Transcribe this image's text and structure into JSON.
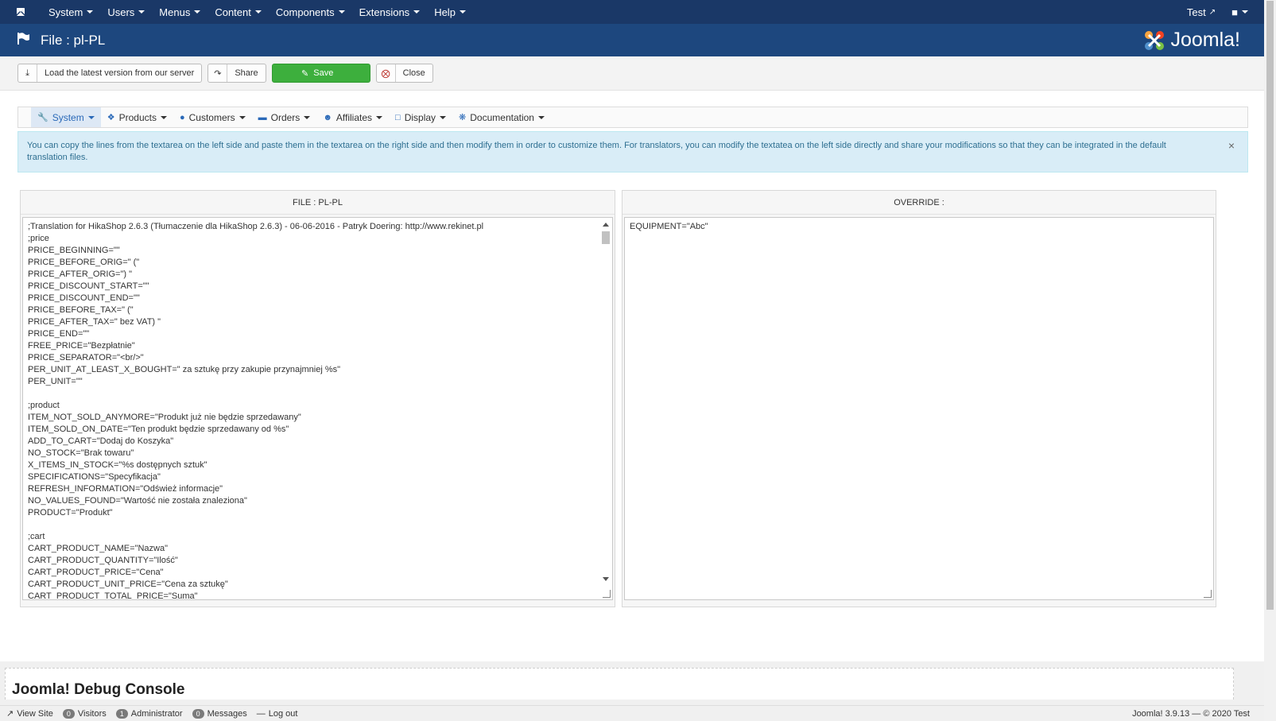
{
  "topnav": {
    "menus": [
      "System",
      "Users",
      "Menus",
      "Content",
      "Components",
      "Extensions",
      "Help"
    ],
    "user_link": "Test"
  },
  "header": {
    "title": "File : pl-PL",
    "brand": "Joomla!"
  },
  "toolbar": {
    "load_label": "Load the latest version from our server",
    "share_label": "Share",
    "save_label": "Save",
    "close_label": "Close"
  },
  "subnav": {
    "items": [
      "System",
      "Products",
      "Customers",
      "Orders",
      "Affiliates",
      "Display",
      "Documentation"
    ],
    "active": "System"
  },
  "alert": {
    "text": "You can copy the lines from the textarea on the left side and paste them in the textarea on the right side and then modify them in order to customize them. For translators, you can modify the textatea on the left side directly and share your modifications so that they can be integrated in the default translation files."
  },
  "file_panel": {
    "header": "FILE : PL-PL",
    "lines": [
      ";Translation for HikaShop 2.6.3 (Tłumaczenie dla HikaShop 2.6.3) - 06-06-2016 - Patryk Doering: http://www.rekinet.pl",
      ";price",
      "PRICE_BEGINNING=\"\"",
      "PRICE_BEFORE_ORIG=\" (\"",
      "PRICE_AFTER_ORIG=\") \"",
      "PRICE_DISCOUNT_START=\"\"",
      "PRICE_DISCOUNT_END=\"\"",
      "PRICE_BEFORE_TAX=\" (\"",
      "PRICE_AFTER_TAX=\" bez VAT) \"",
      "PRICE_END=\"\"",
      "FREE_PRICE=\"Bezpłatnie\"",
      "PRICE_SEPARATOR=\"<br/>\"",
      "PER_UNIT_AT_LEAST_X_BOUGHT=\" za sztukę przy zakupie przynajmniej %s\"",
      "PER_UNIT=\"\"",
      "",
      ";product",
      "ITEM_NOT_SOLD_ANYMORE=\"Produkt już nie będzie sprzedawany\"",
      "ITEM_SOLD_ON_DATE=\"Ten produkt będzie sprzedawany od %s\"",
      "ADD_TO_CART=\"Dodaj do Koszyka\"",
      "NO_STOCK=\"Brak towaru\"",
      "X_ITEMS_IN_STOCK=\"%s dostępnych sztuk\"",
      "SPECIFICATIONS=\"Specyfikacja\"",
      "REFRESH_INFORMATION=\"Odśwież informacje\"",
      "NO_VALUES_FOUND=\"Wartość nie została znaleziona\"",
      "PRODUCT=\"Produkt\"",
      "",
      ";cart",
      "CART_PRODUCT_NAME=\"Nazwa\"",
      "CART_PRODUCT_QUANTITY=\"Ilość\"",
      "CART_PRODUCT_PRICE=\"Cena\"",
      "CART_PRODUCT_UNIT_PRICE=\"Cena za sztukę\"",
      "CART_PRODUCT_TOTAL_PRICE=\"Suma\""
    ]
  },
  "override_panel": {
    "header": "OVERRIDE :",
    "value": "EQUIPMENT=\"Abc\""
  },
  "debug": {
    "title": "Joomla! Debug Console"
  },
  "statusbar": {
    "view_site": "View Site",
    "visitors_count": "0",
    "visitors_label": "Visitors",
    "admin_count": "1",
    "admin_label": "Administrator",
    "messages_count": "0",
    "messages_label": "Messages",
    "logout": "Log out",
    "version": "Joomla! 3.9.13 — © 2020 Test"
  },
  "colors": {
    "topnav_bg": "#1a3867",
    "header_bg": "#1d477e",
    "save_green": "#3daf3d",
    "alert_bg": "#d9edf7",
    "accent_blue": "#2a69b8"
  }
}
